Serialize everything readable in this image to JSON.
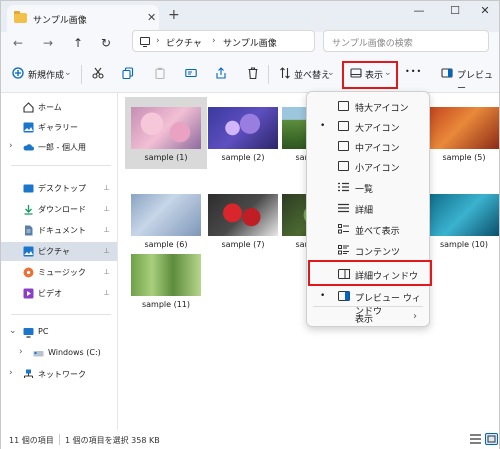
{
  "window": {
    "tab_title": "サンプル画像",
    "new_tab": "+",
    "minimize": "—",
    "maximize": "☐",
    "close": "✕",
    "tab_close": "✕"
  },
  "nav": {
    "back": "←",
    "forward": "→",
    "up": "↑",
    "refresh": "↻",
    "crumb_sep": "›",
    "breadcrumb": [
      "ピクチャ",
      "サンプル画像"
    ],
    "search_placeholder": "サンプル画像の検索"
  },
  "toolbar": {
    "new_label": "新規作成",
    "sort_label": "並べ替え",
    "view_label": "表示",
    "more": "•••",
    "preview_label": "プレビュー",
    "caret": "⌄",
    "accent": "#0067c0",
    "highlight": "#e01a1a"
  },
  "sidebar": {
    "items": [
      {
        "label": "ホーム",
        "icon": "home-icon"
      },
      {
        "label": "ギャラリー",
        "icon": "gallery-icon"
      },
      {
        "label": "一郎 - 個人用",
        "icon": "cloud-icon"
      },
      {
        "label": "デスクトップ",
        "icon": "desktop-icon"
      },
      {
        "label": "ダウンロード",
        "icon": "download-icon"
      },
      {
        "label": "ドキュメント",
        "icon": "document-icon"
      },
      {
        "label": "ピクチャ",
        "icon": "pictures-icon"
      },
      {
        "label": "ミュージック",
        "icon": "music-icon"
      },
      {
        "label": "ビデオ",
        "icon": "video-icon"
      },
      {
        "label": "PC",
        "icon": "pc-icon"
      },
      {
        "label": "Windows (C:)",
        "icon": "drive-icon"
      },
      {
        "label": "ネットワーク",
        "icon": "network-icon"
      }
    ],
    "pin": "📌",
    "chevron_right": "›",
    "chevron_down": "⌄"
  },
  "files": [
    {
      "name": "sample (1)"
    },
    {
      "name": "sample (2)"
    },
    {
      "name": "sample (3)"
    },
    {
      "name": "sample (5)"
    },
    {
      "name": "sample (6)"
    },
    {
      "name": "sample (7)"
    },
    {
      "name": "sample (8)"
    },
    {
      "name": "sample (10)"
    },
    {
      "name": "sample (11)"
    }
  ],
  "menu": {
    "items": [
      {
        "label": "特大アイコン",
        "checked": false
      },
      {
        "label": "大アイコン",
        "checked": true
      },
      {
        "label": "中アイコン",
        "checked": false
      },
      {
        "label": "小アイコン",
        "checked": false
      },
      {
        "label": "一覧",
        "checked": false
      },
      {
        "label": "詳細",
        "checked": false
      },
      {
        "label": "並べて表示",
        "checked": false
      },
      {
        "label": "コンテンツ",
        "checked": false
      },
      {
        "label": "詳細ウィンドウ",
        "checked": false
      },
      {
        "label": "プレビュー ウィンドウ",
        "checked": true
      },
      {
        "label": "表示",
        "checked": false
      }
    ],
    "bullet": "•",
    "submenu_arrow": "›"
  },
  "status": {
    "item_count": "11 個の項目",
    "selection": "1 個の項目を選択 358 KB"
  }
}
